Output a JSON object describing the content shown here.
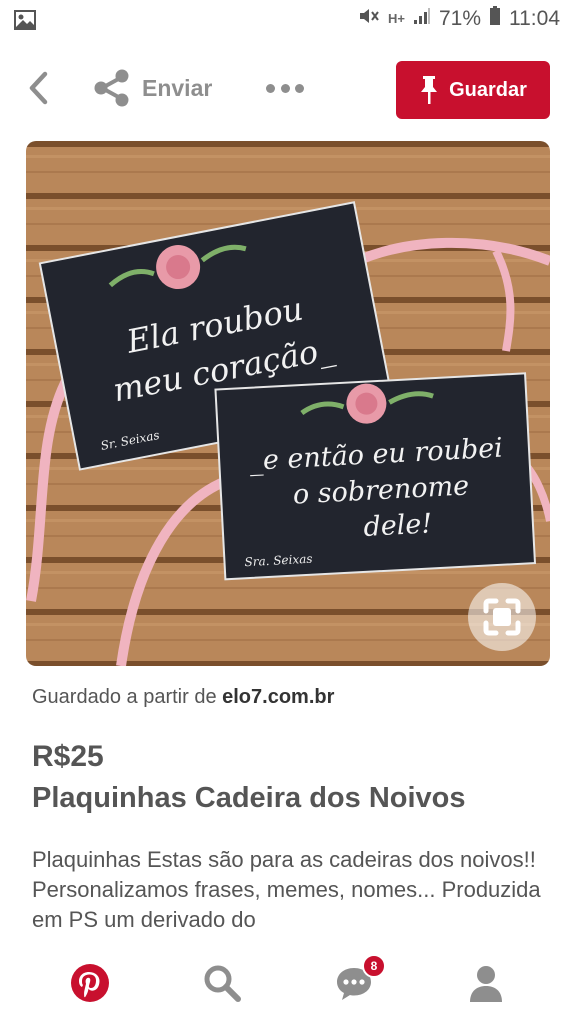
{
  "status_bar": {
    "battery": "71%",
    "time": "11:04",
    "network": "H+"
  },
  "action_bar": {
    "back_icon": "chevron-left-icon",
    "share_label": "Enviar",
    "more_icon": "more-horizontal-icon",
    "save_label": "Guardar"
  },
  "pin": {
    "image": {
      "sign1_line1": "Ela roubou",
      "sign1_line2": "meu coração_",
      "sign1_signature": "Sr. Seixas",
      "sign2_line1": "_e então eu roubei",
      "sign2_line2": "o sobrenome",
      "sign2_line3": "dele!",
      "sign2_signature": "Sra. Seixas"
    },
    "source_prefix": "Guardado a partir de",
    "source_domain": "elo7.com.br",
    "price": "R$25",
    "title": "Plaquinhas Cadeira dos Noivos",
    "description": "Plaquinhas Estas são para as cadeiras dos noivos!! Personalizamos frases, memes, nomes... Produzida em PS um derivado do"
  },
  "bottom_nav": {
    "notification_count": "8",
    "items": [
      "home",
      "search",
      "notifications",
      "profile"
    ]
  },
  "colors": {
    "brand": "#c8102e",
    "text": "#555555",
    "icon_gray": "#8e8e8e"
  }
}
